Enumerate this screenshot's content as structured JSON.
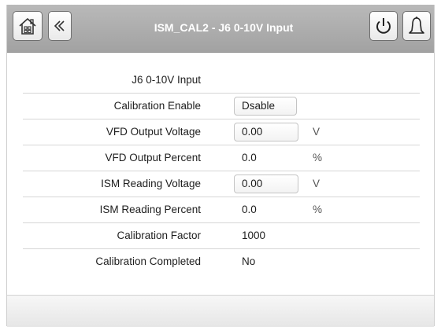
{
  "header": {
    "title": "ISM_CAL2 - J6 0-10V Input",
    "icons": {
      "home": "home-icon",
      "back": "back-chevron-icon",
      "power": "power-icon",
      "alarm": "bell-icon"
    }
  },
  "rows": [
    {
      "label": "J6 0-10V Input",
      "value": "",
      "unit": ""
    },
    {
      "label": "Calibration Enable",
      "value": "Dsable",
      "unit": ""
    },
    {
      "label": "VFD Output Voltage",
      "value": "0.00",
      "unit": "V"
    },
    {
      "label": "VFD Output Percent",
      "value": "0.0",
      "unit": "%"
    },
    {
      "label": "ISM Reading Voltage",
      "value": "0.00",
      "unit": "V"
    },
    {
      "label": "ISM Reading Percent",
      "value": "0.0",
      "unit": "%"
    },
    {
      "label": "Calibration Factor",
      "value": "1000",
      "unit": ""
    },
    {
      "label": "Calibration Completed",
      "value": "No",
      "unit": ""
    }
  ],
  "colors": {
    "header_bg": "#a9a9a9",
    "header_text": "#ffffff",
    "text": "#1e1e1e"
  }
}
